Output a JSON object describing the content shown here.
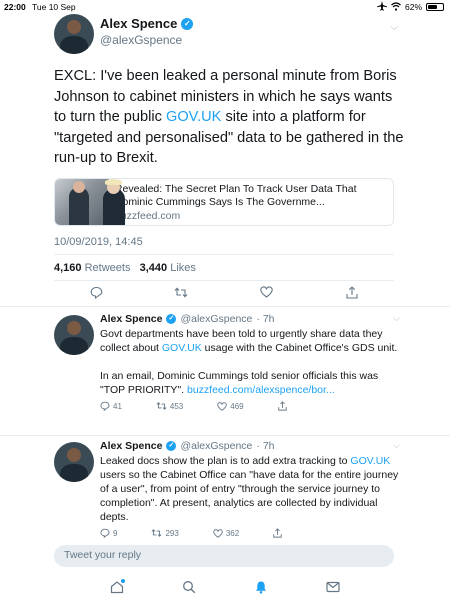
{
  "status_bar": {
    "time": "22:00",
    "date": "Tue 10 Sep",
    "battery_text": "62%",
    "battery_level": 0.62
  },
  "main_tweet": {
    "name": "Alex Spence",
    "handle": "@alexGspence",
    "text_before": "EXCL: I've been leaked a personal minute from Boris Johnson to cabinet ministers in which he says wants to turn the public ",
    "link": "GOV.UK",
    "text_after": " site into a platform for \"targeted and personalised\" data to be gathered in the run-up to Brexit.",
    "card": {
      "title": "Revealed: The Secret Plan To Track User Data That Dominic Cummings Says Is The Governme...",
      "domain": "buzzfeed.com"
    },
    "timestamp": "10/09/2019, 14:45",
    "retweets_count": "4,160",
    "retweets_label": "Retweets",
    "likes_count": "3,440",
    "likes_label": "Likes"
  },
  "replies": [
    {
      "name": "Alex Spence",
      "handle": "@alexGspence",
      "age": "· 7h",
      "p1_before": "Govt departments have been told to urgently share data they collect about ",
      "p1_link": "GOV.UK",
      "p1_after": " usage with the Cabinet Office's GDS unit.",
      "p2_before": "In an email, Dominic Cummings told senior officials this was \"TOP PRIORITY\". ",
      "p2_link": "buzzfeed.com/alexspence/bor...",
      "replies_count": "41",
      "retweets_count": "453",
      "likes_count": "469"
    },
    {
      "name": "Alex Spence",
      "handle": "@alexGspence",
      "age": "· 7h",
      "p1_before": "Leaked docs show the plan is to add extra tracking to ",
      "p1_link": "GOV.UK",
      "p1_after": " users so the Cabinet Office can \"have data for the entire journey of a user\", from point of entry \"through the service journey to completion\". At present, analytics are collected by individual depts.",
      "replies_count": "9",
      "retweets_count": "293",
      "likes_count": "362"
    }
  ],
  "composer": {
    "placeholder": "Tweet your reply"
  },
  "colors": {
    "accent": "#1da1f2",
    "text": "#14171a",
    "muted": "#657786",
    "divider": "#e6ecf0"
  },
  "icons": [
    "airplane-icon",
    "wifi-icon",
    "battery-icon",
    "verified-badge-icon",
    "chevron-down-icon",
    "reply-icon",
    "retweet-icon",
    "like-icon",
    "share-icon",
    "home-icon",
    "search-icon",
    "notifications-icon",
    "messages-icon"
  ]
}
